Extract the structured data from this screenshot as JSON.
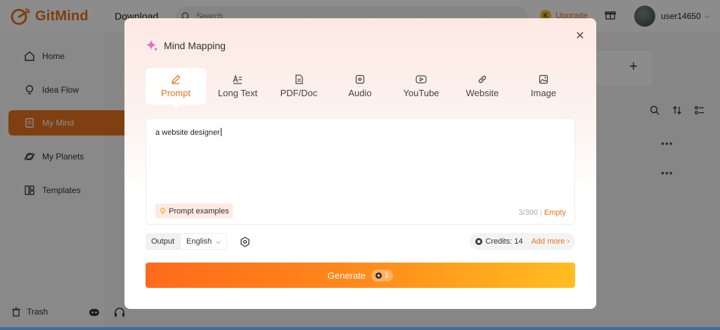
{
  "app": {
    "brand": "GitMind",
    "nav_download": "Download",
    "search_placeholder": "Search",
    "upgrade": "Upgrade",
    "upgrade_coin": "K",
    "username": "user14650"
  },
  "sidebar": {
    "items": [
      {
        "label": "Home",
        "icon": "home-icon"
      },
      {
        "label": "Idea Flow",
        "icon": "bulb-icon"
      },
      {
        "label": "My Mind",
        "icon": "document-icon",
        "active": true
      },
      {
        "label": "My Planets",
        "icon": "planet-icon"
      },
      {
        "label": "Templates",
        "icon": "templates-icon"
      }
    ],
    "trash": "Trash"
  },
  "modal": {
    "title": "Mind Mapping",
    "tabs": [
      {
        "label": "Prompt",
        "icon": "pen-icon",
        "active": true
      },
      {
        "label": "Long Text",
        "icon": "text-icon"
      },
      {
        "label": "PDF/Doc",
        "icon": "file-icon"
      },
      {
        "label": "Audio",
        "icon": "audio-icon"
      },
      {
        "label": "YouTube",
        "icon": "youtube-icon"
      },
      {
        "label": "Website",
        "icon": "link-icon"
      },
      {
        "label": "Image",
        "icon": "image-icon"
      }
    ],
    "prompt": {
      "value": "a website designer",
      "examples_label": "Prompt examples",
      "counter": "3/300",
      "clear_label": "Empty"
    },
    "output": {
      "label": "Output",
      "language": "English"
    },
    "credits": {
      "label": "Credits: 14",
      "add_more": "Add more ›"
    },
    "generate": {
      "label": "Generate",
      "cost": "1"
    }
  },
  "colors": {
    "accent": "#e8731f",
    "generate_start": "#ff6a1a",
    "generate_end": "#ffbe20"
  }
}
